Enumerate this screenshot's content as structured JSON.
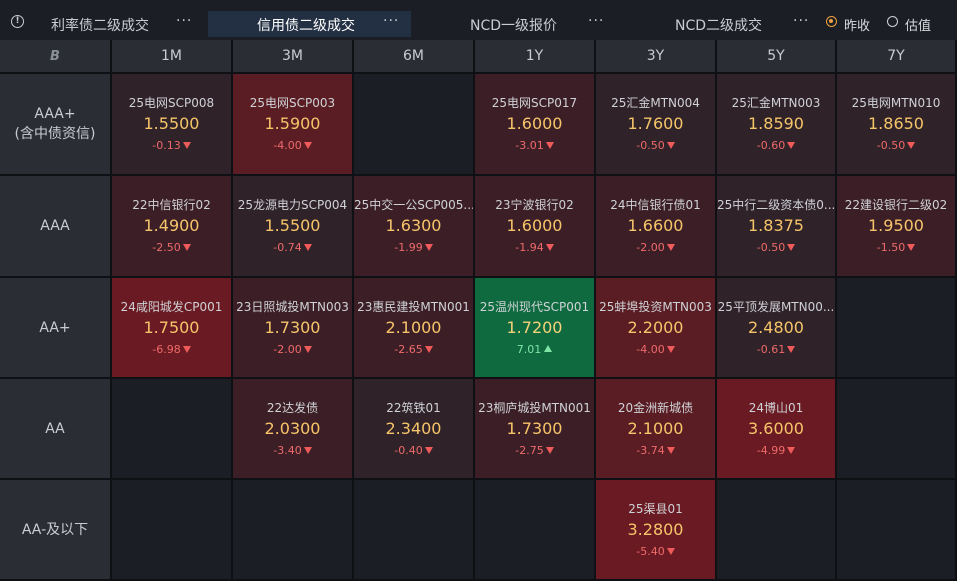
{
  "tabs": [
    {
      "label": "利率债二级成交",
      "more": "···",
      "active": false
    },
    {
      "label": "信用债二级成交",
      "more": "···",
      "active": true
    },
    {
      "label": "NCD一级报价",
      "more": "···",
      "active": false
    },
    {
      "label": "NCD二级成交",
      "more": "···",
      "active": false
    }
  ],
  "options": [
    {
      "label": "昨收",
      "selected": true
    },
    {
      "label": "估值",
      "selected": false
    }
  ],
  "columns": [
    "1M",
    "3M",
    "6M",
    "1Y",
    "3Y",
    "5Y",
    "7Y"
  ],
  "rows": [
    {
      "label": "AAA+\n(含中债资信)",
      "cells": [
        {
          "bond": "25电网SCP008",
          "yield": "1.5500",
          "change": "-0.13",
          "dir": "down",
          "tone": "dark"
        },
        {
          "bond": "25电网SCP003",
          "yield": "1.5900",
          "change": "-4.00",
          "dir": "down",
          "tone": "red"
        },
        null,
        {
          "bond": "25电网SCP017",
          "yield": "1.6000",
          "change": "-3.01",
          "dir": "down",
          "tone": "mid"
        },
        {
          "bond": "25汇金MTN004",
          "yield": "1.7600",
          "change": "-0.50",
          "dir": "down",
          "tone": "dark"
        },
        {
          "bond": "25汇金MTN003",
          "yield": "1.8590",
          "change": "-0.60",
          "dir": "down",
          "tone": "dark"
        },
        {
          "bond": "25电网MTN010",
          "yield": "1.8650",
          "change": "-0.50",
          "dir": "down",
          "tone": "dark"
        }
      ]
    },
    {
      "label": "AAA",
      "cells": [
        {
          "bond": "22中信银行02",
          "yield": "1.4900",
          "change": "-2.50",
          "dir": "down",
          "tone": "mid"
        },
        {
          "bond": "25龙源电力SCP004",
          "yield": "1.5500",
          "change": "-0.74",
          "dir": "down",
          "tone": "dark"
        },
        {
          "bond": "25中交一公SCP005...",
          "yield": "1.6300",
          "change": "-1.99",
          "dir": "down",
          "tone": "mid"
        },
        {
          "bond": "23宁波银行02",
          "yield": "1.6000",
          "change": "-1.94",
          "dir": "down",
          "tone": "mid"
        },
        {
          "bond": "24中信银行债01",
          "yield": "1.6600",
          "change": "-2.00",
          "dir": "down",
          "tone": "mid"
        },
        {
          "bond": "25中行二级资本债0...",
          "yield": "1.8375",
          "change": "-0.50",
          "dir": "down",
          "tone": "dark"
        },
        {
          "bond": "22建设银行二级02",
          "yield": "1.9500",
          "change": "-1.50",
          "dir": "down",
          "tone": "mid"
        }
      ]
    },
    {
      "label": "AA+",
      "cells": [
        {
          "bond": "24咸阳城发CP001",
          "yield": "1.7500",
          "change": "-6.98",
          "dir": "down",
          "tone": "bright"
        },
        {
          "bond": "23日照城投MTN003",
          "yield": "1.7300",
          "change": "-2.00",
          "dir": "down",
          "tone": "mid"
        },
        {
          "bond": "23惠民建投MTN001",
          "yield": "2.1000",
          "change": "-2.65",
          "dir": "down",
          "tone": "mid"
        },
        {
          "bond": "25温州现代SCP001",
          "yield": "1.7200",
          "change": "7.01",
          "dir": "up",
          "tone": "green"
        },
        {
          "bond": "25蚌埠投资MTN003",
          "yield": "2.2000",
          "change": "-4.00",
          "dir": "down",
          "tone": "red"
        },
        {
          "bond": "25平顶发展MTN00...",
          "yield": "2.4800",
          "change": "-0.61",
          "dir": "down",
          "tone": "dark"
        },
        null
      ]
    },
    {
      "label": "AA",
      "cells": [
        null,
        {
          "bond": "22达发债",
          "yield": "2.0300",
          "change": "-3.40",
          "dir": "down",
          "tone": "mid"
        },
        {
          "bond": "22筑铁01",
          "yield": "2.3400",
          "change": "-0.40",
          "dir": "down",
          "tone": "dark"
        },
        {
          "bond": "23桐庐城投MTN001",
          "yield": "1.7300",
          "change": "-2.75",
          "dir": "down",
          "tone": "mid"
        },
        {
          "bond": "20金洲新城债",
          "yield": "2.1000",
          "change": "-3.74",
          "dir": "down",
          "tone": "red"
        },
        {
          "bond": "24博山01",
          "yield": "3.6000",
          "change": "-4.99",
          "dir": "down",
          "tone": "bright"
        },
        null
      ]
    },
    {
      "label": "AA-及以下",
      "cells": [
        null,
        null,
        null,
        null,
        {
          "bond": "25渠县01",
          "yield": "3.2800",
          "change": "-5.40",
          "dir": "down",
          "tone": "bright"
        },
        null,
        null
      ]
    }
  ]
}
